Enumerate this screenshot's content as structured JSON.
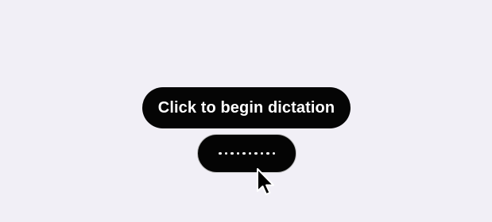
{
  "tooltip": {
    "label": "Click to begin dictation"
  },
  "dictation_button": {
    "indicator": "..........",
    "dot_count": 10
  },
  "colors": {
    "background": "#f1eff6",
    "pill": "#050505",
    "text": "#ffffff",
    "border": "#bdbdbd"
  },
  "cursor": {
    "icon": "arrow-pointer-icon"
  }
}
